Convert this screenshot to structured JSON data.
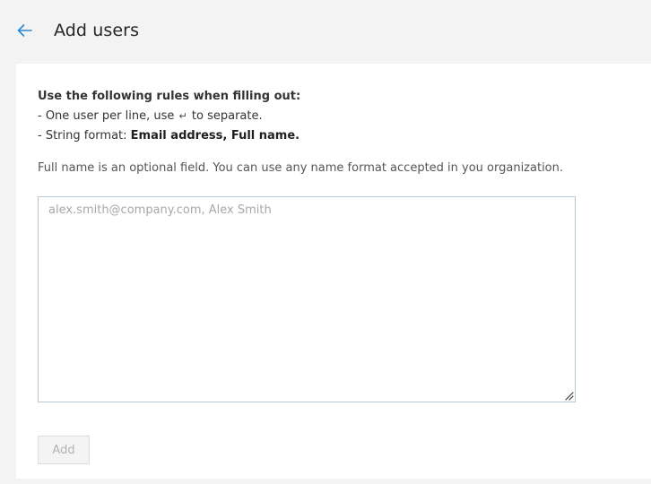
{
  "header": {
    "title": "Add users",
    "back_icon": "arrow-left-icon",
    "accent_color": "#2b88d8"
  },
  "rules": {
    "heading": "Use the following rules when filling out:",
    "line1_prefix": "- One user per line, use",
    "line1_glyph": "↵",
    "line1_suffix": "to separate.",
    "line2_prefix": "- String format:",
    "line2_emphasis": "Email address, Full name."
  },
  "note": "Full name is an optional field. You can use any name format accepted in you organization.",
  "users_input": {
    "value": "",
    "placeholder": "alex.smith@company.com, Alex Smith"
  },
  "actions": {
    "add_label": "Add",
    "add_disabled": true
  }
}
